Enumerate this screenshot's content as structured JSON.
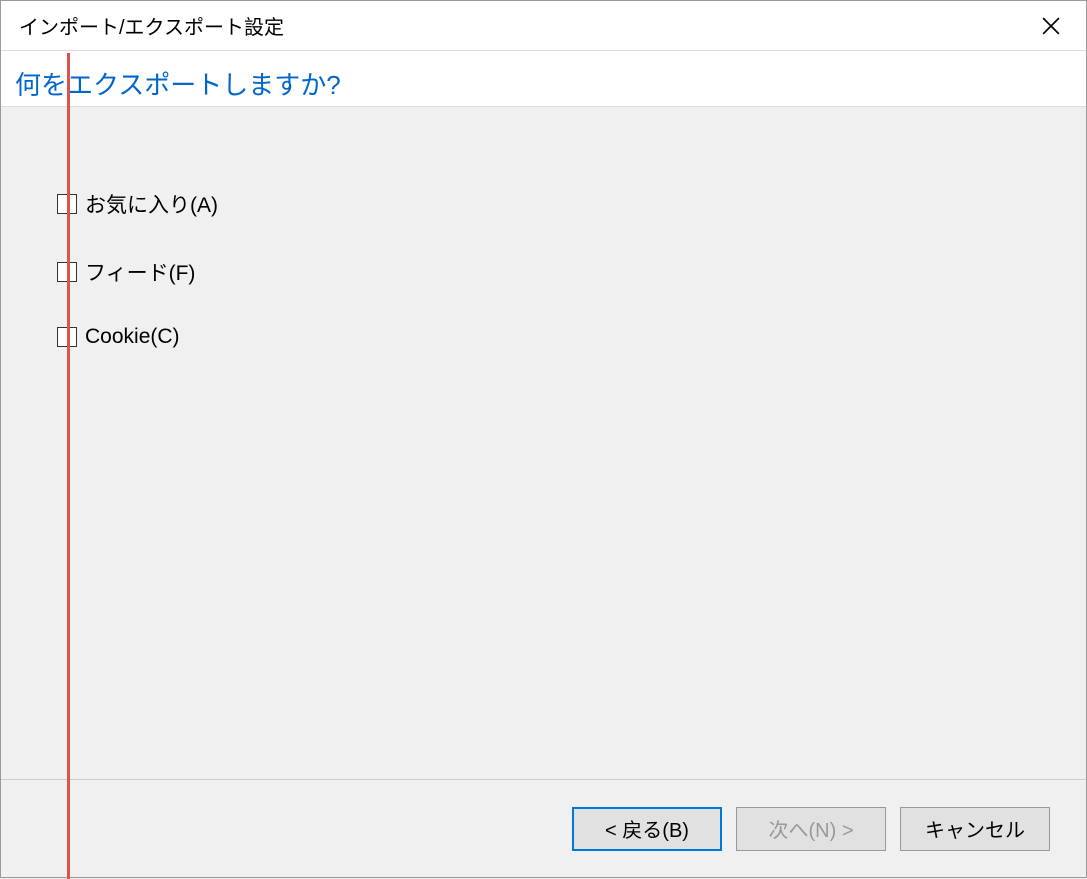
{
  "titlebar": {
    "title": "インポート/エクスポート設定",
    "close_icon_name": "close-icon"
  },
  "header": {
    "question": "何をエクスポートしますか?"
  },
  "options": [
    {
      "label": "お気に入り(A)",
      "checked": false,
      "name": "checkbox-favorites"
    },
    {
      "label": "フィード(F)",
      "checked": false,
      "name": "checkbox-feed"
    },
    {
      "label": "Cookie(C)",
      "checked": false,
      "name": "checkbox-cookie"
    }
  ],
  "footer": {
    "back_label": "< 戻る(B)",
    "next_label": "次へ(N) >",
    "cancel_label": "キャンセル",
    "next_disabled": true
  },
  "annotation": {
    "color": "#d9534f"
  }
}
